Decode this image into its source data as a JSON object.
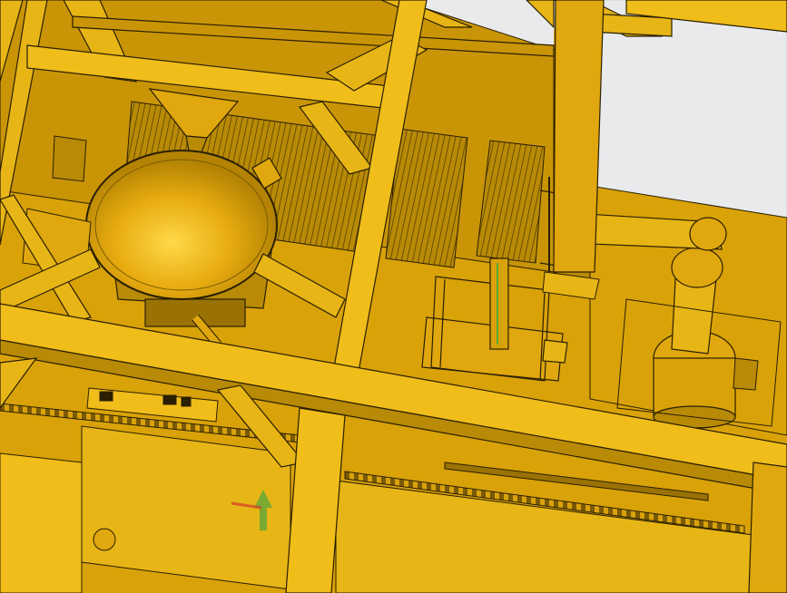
{
  "scene": {
    "description_tags": [
      "cad-render",
      "robotic-cell",
      "frame-structure"
    ],
    "colors": {
      "sky": "#e9eaec",
      "sky_edge": "#cfd1d4",
      "metal": "#d9a208",
      "metal_light": "#f0bd1a",
      "metal_dark": "#b88a05",
      "metal_shadow": "#8e6904",
      "line": "#2a1f00",
      "accent_green": "#5fa83a",
      "accent_red": "#d63a2a"
    },
    "icons": [
      "funnel-icon",
      "bowl-icon",
      "robot-arm-icon",
      "conveyor-icon",
      "grating-icon"
    ]
  }
}
